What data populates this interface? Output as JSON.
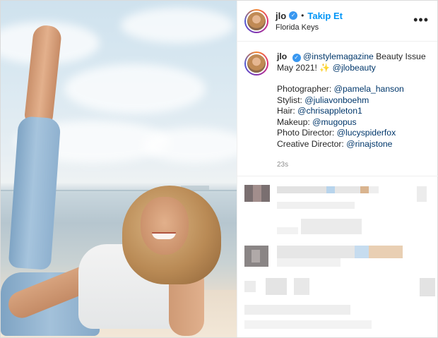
{
  "post": {
    "header": {
      "username": "jlo",
      "verified_icon": "verified-badge-icon",
      "separator": "•",
      "follow_label": "Takip Et",
      "location": "Florida Keys",
      "more_icon": "more-options-icon",
      "more_glyph": "•••"
    },
    "caption": {
      "username": "jlo",
      "mention_magazine": "@instylemagazine",
      "text_beauty": " Beauty Issue",
      "text_date": "May 2021! ",
      "emoji": "✨",
      "mention_brand": "@jlobeauty",
      "credits": [
        {
          "label": "Photographer: ",
          "handle": "@pamela_hanson"
        },
        {
          "label": "Stylist: ",
          "handle": "@juliavonboehm"
        },
        {
          "label": "Hair: ",
          "handle": "@chrisappleton1"
        },
        {
          "label": "Makeup: ",
          "handle": "@mugopus"
        },
        {
          "label": "Photo Director: ",
          "handle": "@lucyspiderfox"
        },
        {
          "label": "Creative Director: ",
          "handle": "@rinajstone"
        }
      ],
      "timestamp": "23s"
    },
    "colors": {
      "accent_blue": "#0095f6",
      "link_dark_blue": "#00376b",
      "text": "#262626",
      "muted": "#8e8e8e",
      "border": "#dbdbdb"
    }
  }
}
